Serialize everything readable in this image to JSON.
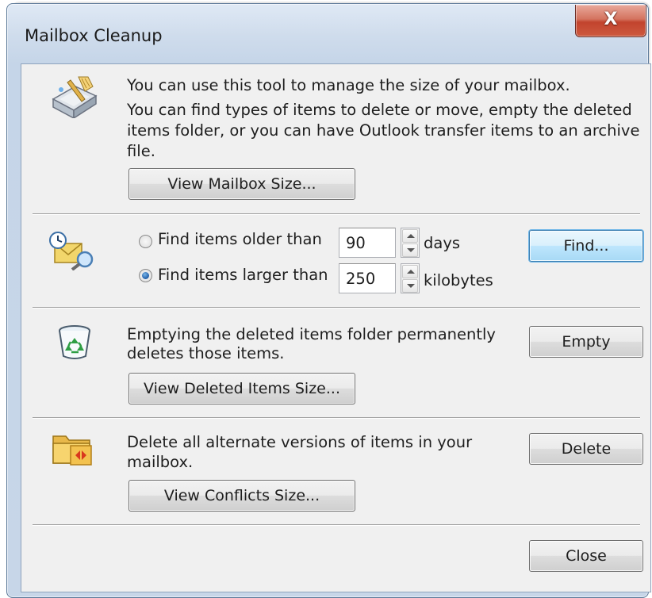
{
  "window": {
    "title": "Mailbox Cleanup",
    "close_glyph": "X"
  },
  "intro": {
    "line1": "You can use this tool to manage the size of your mailbox.",
    "line2": "You can find types of items to delete or move, empty the deleted",
    "line3": "items folder, or you can have Outlook transfer items to an archive",
    "line4": "file.",
    "view_mailbox_size_button": "View Mailbox Size..."
  },
  "find": {
    "older_label": "Find items older than",
    "older_selected": false,
    "older_value": "90",
    "older_unit": "days",
    "larger_label": "Find items larger than",
    "larger_selected": true,
    "larger_value": "250",
    "larger_unit": "kilobytes",
    "find_button": "Find..."
  },
  "deleted": {
    "line1": "Emptying the deleted items folder permanently",
    "line2": "deletes those items.",
    "empty_button": "Empty",
    "view_size_button": "View Deleted Items Size..."
  },
  "conflicts": {
    "line1": "Delete all alternate versions of items in your",
    "line2": "mailbox.",
    "delete_button": "Delete",
    "view_size_button": "View Conflicts Size..."
  },
  "footer": {
    "close_button": "Close"
  },
  "icons": [
    "mailbox-cleanup-icon",
    "clock-search-icon",
    "recycle-bin-icon",
    "conflict-folder-icon"
  ]
}
